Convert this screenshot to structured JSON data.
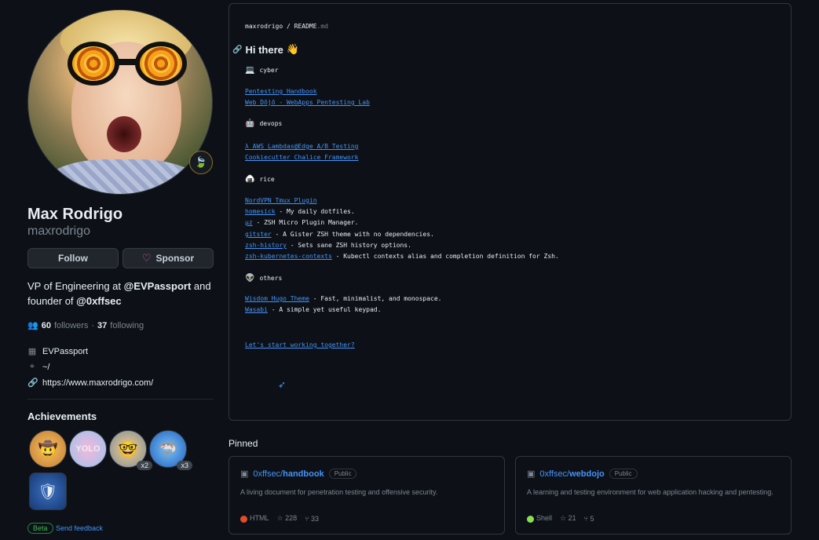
{
  "profile": {
    "name": "Max Rodrigo",
    "login": "maxrodrigo",
    "status_emoji": "🍃",
    "follow_label": "Follow",
    "sponsor_label": "Sponsor",
    "bio_prefix": "VP of Engineering at ",
    "bio_org1": "@EVPassport",
    "bio_mid": " and founder of ",
    "bio_org2": "@0xffsec",
    "followers_count": "60",
    "followers_label": "followers",
    "sep": "·",
    "following_count": "37",
    "following_label": "following",
    "company": "EVPassport",
    "location": "~/",
    "website": "https://www.maxrodrigo.com/"
  },
  "achievements": {
    "title": "Achievements",
    "badges": [
      {
        "name": "pull-shark-badge",
        "glyph": "🤠",
        "count": ""
      },
      {
        "name": "yolo-badge",
        "glyph": "YOLO",
        "count": ""
      },
      {
        "name": "quickdraw-badge",
        "glyph": "🤓",
        "count": "x2"
      },
      {
        "name": "shark-badge",
        "glyph": "🦈",
        "count": "x3"
      },
      {
        "name": "arctic-badge",
        "glyph": "🛡",
        "count": ""
      }
    ],
    "beta_label": "Beta",
    "feedback_label": "Send feedback"
  },
  "readme": {
    "owner": "maxrodrigo",
    "slash": " / ",
    "file": "README",
    "ext": ".md",
    "heading": "Hi there",
    "wave": "👋",
    "sections": {
      "cyber": {
        "emoji": "💻",
        "label": "cyber"
      },
      "devops": {
        "emoji": "🤖",
        "label": "devops"
      },
      "rice": {
        "emoji": "🍙",
        "label": "rice"
      },
      "others": {
        "emoji": "👽",
        "label": "others"
      }
    },
    "links": {
      "pentesting_handbook": "Pentesting Handbook",
      "web_dojo": "Web Dōjō - WebApps Pentesting Lab",
      "lambda": "λ AWS Lambdas@Edge A/B Testing",
      "chalice": "Cookiecutter Chalice Framework",
      "nordvpn": "NordVPN Tmux Plugin",
      "homesick": "homesick",
      "homesick_desc": " - My daily dotfiles.",
      "mz": "μz",
      "mz_desc": " - ZSH Micro Plugin Manager.",
      "gitster": "gitster",
      "gitster_desc": " - A Gister ZSH theme with no dependencies.",
      "zsh_history": "zsh-history",
      "zsh_history_desc": " - Sets sane ZSH history options.",
      "zsh_k8s": "zsh-kubernetes-contexts",
      "zsh_k8s_desc": " - Kubectl contexts alias and completion definition for Zsh.",
      "wisdom": "Wisdom Hugo Theme",
      "wisdom_desc": " - Fast, minimalist, and monospace.",
      "wasabi": "Wasabi",
      "wasabi_desc": " - A simple yet useful keypad.",
      "together": "Let's start working together?"
    }
  },
  "pinned": {
    "title": "Pinned",
    "repos": [
      {
        "owner": "0xffsec/",
        "repo": "handbook",
        "visibility": "Public",
        "description": "A living document for penetration testing and offensive security.",
        "language": "HTML",
        "language_color": "#e34c26",
        "stars": "228",
        "forks": "33"
      },
      {
        "owner": "0xffsec/",
        "repo": "webdojo",
        "visibility": "Public",
        "description": "A learning and testing environment for web application hacking and pentesting.",
        "language": "Shell",
        "language_color": "#89e051",
        "stars": "21",
        "forks": "5"
      }
    ]
  }
}
